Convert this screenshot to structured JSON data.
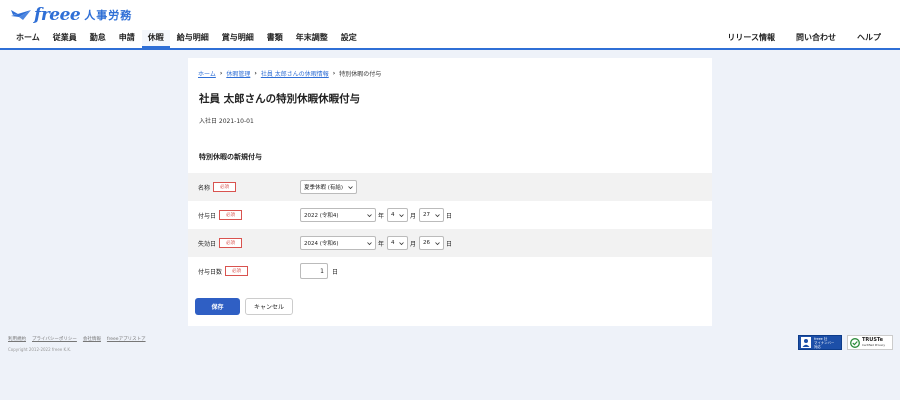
{
  "header": {
    "logo_text": "freee",
    "product_name": "人事労務",
    "nav_items": [
      {
        "label": "ホーム"
      },
      {
        "label": "従業員"
      },
      {
        "label": "勤怠"
      },
      {
        "label": "申請"
      },
      {
        "label": "休暇",
        "active": true
      },
      {
        "label": "給与明細"
      },
      {
        "label": "賞与明細"
      },
      {
        "label": "書類"
      },
      {
        "label": "年末調整"
      },
      {
        "label": "設定"
      }
    ],
    "right_nav": [
      {
        "label": "リリース情報"
      },
      {
        "label": "問い合わせ"
      },
      {
        "label": "ヘルプ"
      }
    ],
    "accent_color": "#2f6fd6"
  },
  "breadcrumb": {
    "home": "ホーム",
    "leave_management": "休暇管理",
    "employee_leave": "社員 太郎さんの休暇情報",
    "current": "特別休暇の付与"
  },
  "page": {
    "title": "社員 太郎さんの特別休暇休暇付与",
    "hire_date": "入社日 2021-10-01",
    "section_title": "特別休暇の新規付与"
  },
  "form": {
    "required_label": "必須",
    "name": {
      "label": "名称",
      "value": "夏季休暇 (有給)"
    },
    "grant_date": {
      "label": "付与日",
      "year": "2022 (令和4)",
      "year_unit": "年",
      "month": "4",
      "month_unit": "月",
      "day": "27",
      "day_unit": "日"
    },
    "expire_date": {
      "label": "失効日",
      "year": "2024 (令和6)",
      "year_unit": "年",
      "month": "4",
      "month_unit": "月",
      "day": "26",
      "day_unit": "日"
    },
    "grant_days": {
      "label": "付与日数",
      "value": "1",
      "unit": "日"
    },
    "save_label": "保存",
    "cancel_label": "キャンセル"
  },
  "footer": {
    "links": [
      "利用規約",
      "プライバシーポリシー",
      "会社情報",
      "freeeアプリストア"
    ],
    "copyright": "Copyright 2012-2022 freee K.K.",
    "mynumber_badge": {
      "line1": "freee 社",
      "line2": "マイナンバー",
      "line3": "対応"
    },
    "truste_badge": {
      "name": "TRUSTe",
      "sub": "Certified Privacy"
    }
  }
}
